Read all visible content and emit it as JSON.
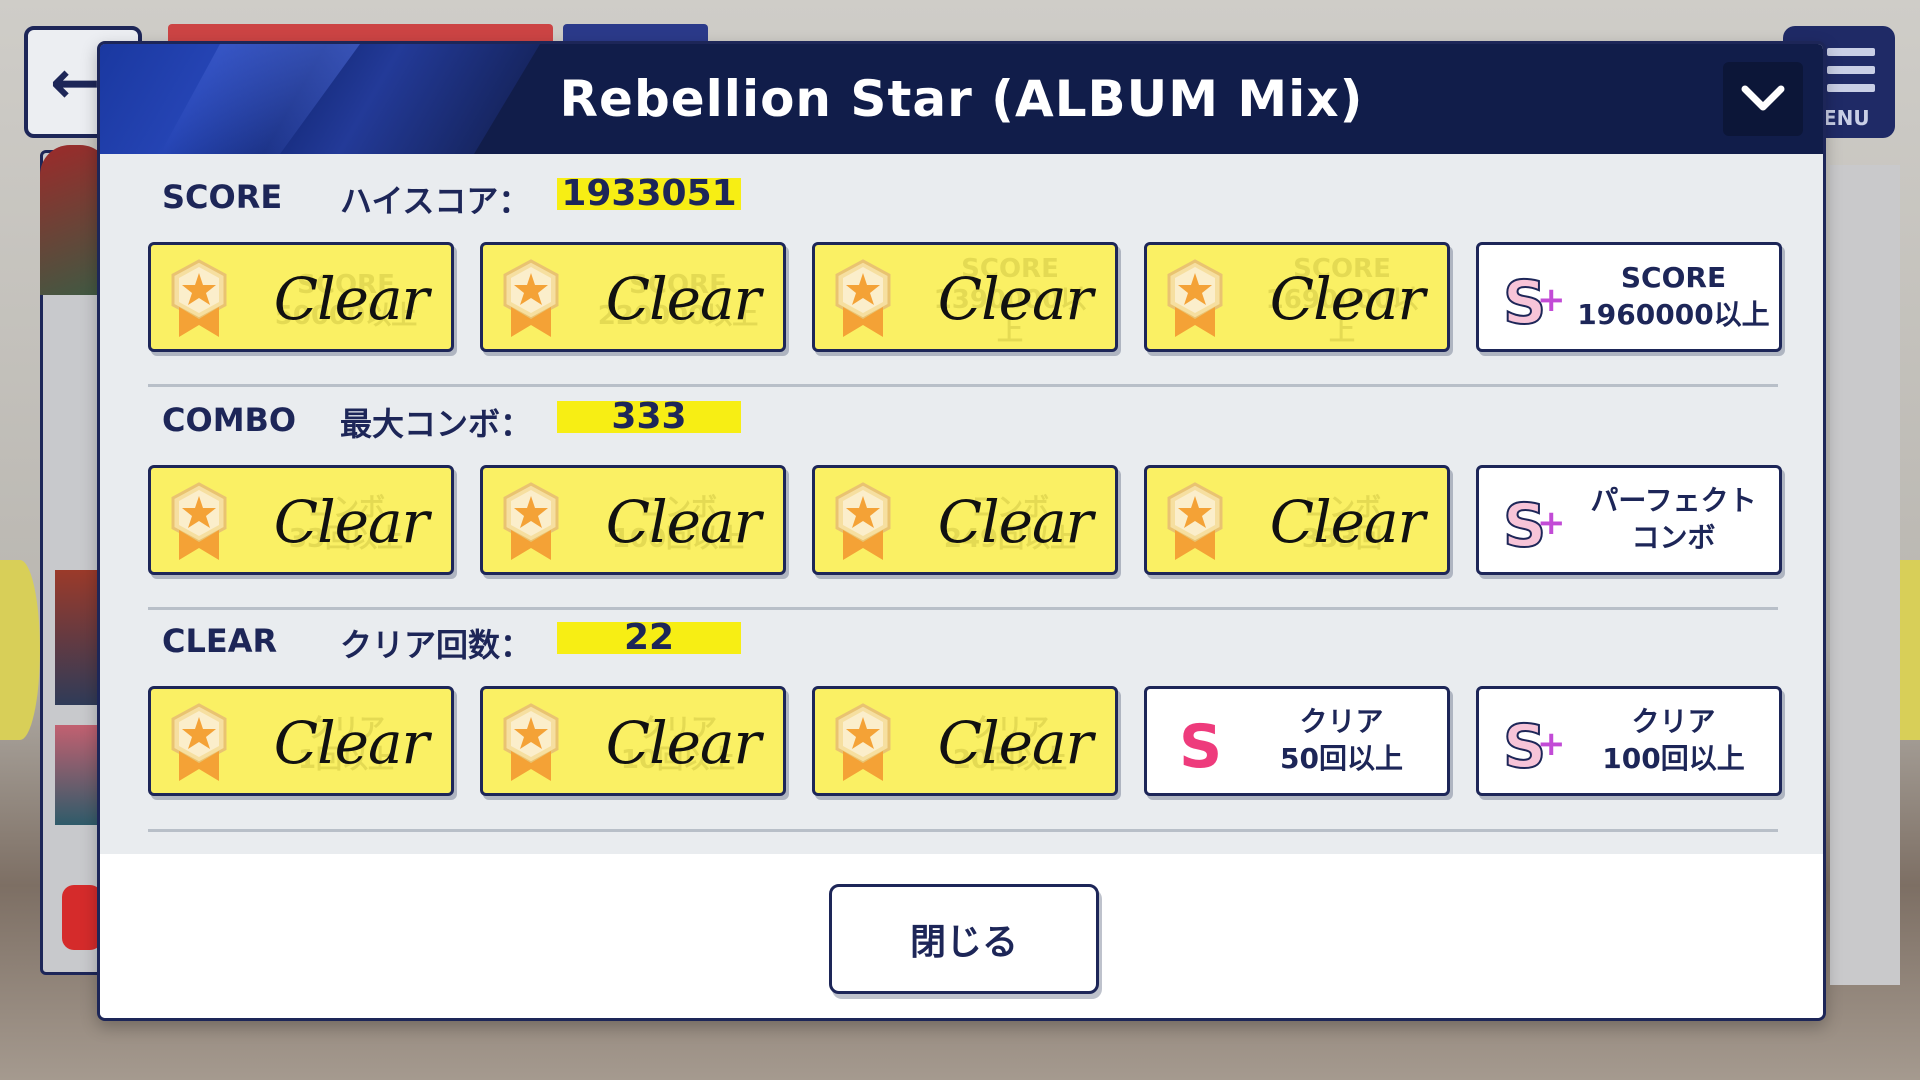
{
  "background": {
    "menu_label": "ENU",
    "back_icon": "arrow-left-icon"
  },
  "modal": {
    "title": "Rebellion Star (ALBUM Mix)",
    "collapse_icon": "chevron-down-icon"
  },
  "sections": [
    {
      "label": "SCORE",
      "sub_label": "ハイスコア：",
      "value": "1933051",
      "cards": [
        {
          "status": "cleared",
          "text": "Clear",
          "ghost": [
            "SCORE",
            "50000以上"
          ]
        },
        {
          "status": "cleared",
          "text": "Clear",
          "ghost": [
            "SCORE",
            "220000以上"
          ]
        },
        {
          "status": "cleared",
          "text": "Clear",
          "ghost": [
            "SCORE",
            "1390000以上"
          ]
        },
        {
          "status": "cleared",
          "text": "Clear",
          "ghost": [
            "SCORE",
            "1690000以上"
          ]
        },
        {
          "status": "open",
          "rank": "S+",
          "req_lines": [
            "SCORE",
            "1960000以上"
          ]
        }
      ]
    },
    {
      "label": "COMBO",
      "sub_label": "最大コンボ：",
      "value": "333",
      "cards": [
        {
          "status": "cleared",
          "text": "Clear",
          "ghost": [
            "コンボ",
            "33回以上"
          ]
        },
        {
          "status": "cleared",
          "text": "Clear",
          "ghost": [
            "コンボ",
            "100回以上"
          ]
        },
        {
          "status": "cleared",
          "text": "Clear",
          "ghost": [
            "コンボ",
            "249回以上"
          ]
        },
        {
          "status": "cleared",
          "text": "Clear",
          "ghost": [
            "コンボ",
            "333回"
          ]
        },
        {
          "status": "open",
          "rank": "S+",
          "req_lines": [
            "パーフェクト",
            "コンボ"
          ]
        }
      ]
    },
    {
      "label": "CLEAR",
      "sub_label": "クリア回数：",
      "value": "22",
      "cards": [
        {
          "status": "cleared",
          "text": "Clear",
          "ghost": [
            "クリア",
            "1回以上"
          ]
        },
        {
          "status": "cleared",
          "text": "Clear",
          "ghost": [
            "クリア",
            "10回以上"
          ]
        },
        {
          "status": "cleared",
          "text": "Clear",
          "ghost": [
            "クリア",
            "20回以上"
          ]
        },
        {
          "status": "open",
          "rank": "S",
          "req_lines": [
            "クリア",
            "50回以上"
          ]
        },
        {
          "status": "open",
          "rank": "S+",
          "req_lines": [
            "クリア",
            "100回以上"
          ]
        }
      ]
    }
  ],
  "footer": {
    "close_label": "閉じる"
  },
  "colors": {
    "navy": "#1d2658",
    "cleared_yellow": "#faf064",
    "value_highlight": "#f7ee14",
    "rank_pink": "#ee3b7c",
    "medal_orange": "#f4a236"
  }
}
